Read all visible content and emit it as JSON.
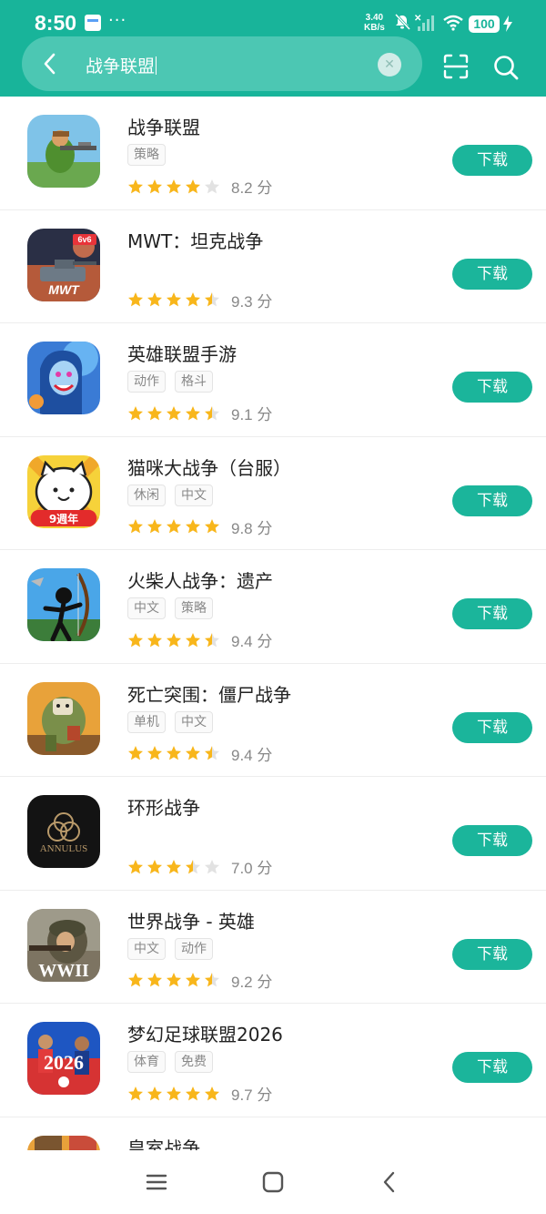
{
  "status_bar": {
    "time": "8:50",
    "dots": "···",
    "net_speed_value": "3.40",
    "net_speed_unit": "KB/s",
    "battery": "100"
  },
  "search": {
    "query": "战争联盟"
  },
  "apps": [
    {
      "name": "战争联盟",
      "tags": [
        "策略"
      ],
      "score": "8.2 分",
      "rating": 4.0,
      "icon": "soldier-sniper",
      "button": "下载"
    },
    {
      "name": "MWT：坦克战争",
      "tags": [],
      "score": "9.3 分",
      "rating": 4.5,
      "icon": "tank-battles",
      "button": "下载"
    },
    {
      "name": "英雄联盟手游",
      "tags": [
        "动作",
        "格斗"
      ],
      "score": "9.1 分",
      "rating": 4.5,
      "icon": "jinx-hero",
      "button": "下载"
    },
    {
      "name": "猫咪大战争（台服）",
      "tags": [
        "休闲",
        "中文"
      ],
      "score": "9.8 分",
      "rating": 5.0,
      "icon": "battle-cat",
      "button": "下载",
      "icon_badge": "9週年"
    },
    {
      "name": "火柴人战争：遗产",
      "tags": [
        "中文",
        "策略"
      ],
      "score": "9.4 分",
      "rating": 4.5,
      "icon": "stickman-archer",
      "button": "下载"
    },
    {
      "name": "死亡突围：僵尸战争",
      "tags": [
        "单机",
        "中文"
      ],
      "score": "9.4 分",
      "rating": 4.5,
      "icon": "zombie-brute",
      "button": "下载"
    },
    {
      "name": "环形战争",
      "tags": [],
      "score": "7.0 分",
      "rating": 3.5,
      "icon": "annulus-logo",
      "button": "下载",
      "icon_label": "ANNULUS"
    },
    {
      "name": "世界战争 - 英雄",
      "tags": [
        "中文",
        "动作"
      ],
      "score": "9.2 分",
      "rating": 4.5,
      "icon": "ww2-soldier",
      "button": "下载",
      "icon_label": "WWII"
    },
    {
      "name": "梦幻足球联盟2026",
      "tags": [
        "体育",
        "免费"
      ],
      "score": "9.7 分",
      "rating": 5.0,
      "icon": "football-players",
      "button": "下载",
      "icon_label": "2026"
    }
  ],
  "partial_app": {
    "name": "皇室战争",
    "icon": "clash-royale"
  },
  "colors": {
    "accent": "#18b49a",
    "star_filled": "#f8b61b",
    "star_empty": "#e2e2e2"
  },
  "nav": [
    "menu-icon",
    "home-icon",
    "back-icon"
  ]
}
